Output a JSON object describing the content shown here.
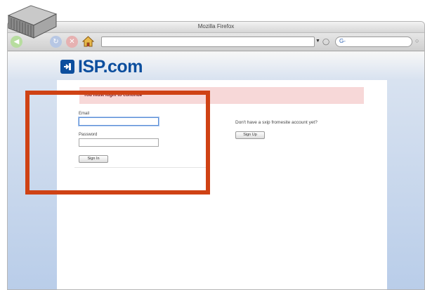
{
  "browser": {
    "window_title": "Mozilla Firefox",
    "url": "",
    "search_text": "G-"
  },
  "site": {
    "logo_text": "ISP.com"
  },
  "login": {
    "alert": "You must login to continue",
    "email_label": "Email",
    "email_value": "",
    "password_label": "Password",
    "password_value": "",
    "signin_label": "Sign In"
  },
  "register": {
    "prompt": "Don't have a sxip fromesite account yet?",
    "signup_label": "Sign Up"
  },
  "colors": {
    "highlight": "#cf4214",
    "logo_blue": "#0d4f9e",
    "alert_bg": "#f7d8d8"
  },
  "icons": [
    "server-icon",
    "back-icon",
    "reload-icon",
    "stop-icon",
    "home-icon",
    "logo-mark-icon"
  ]
}
